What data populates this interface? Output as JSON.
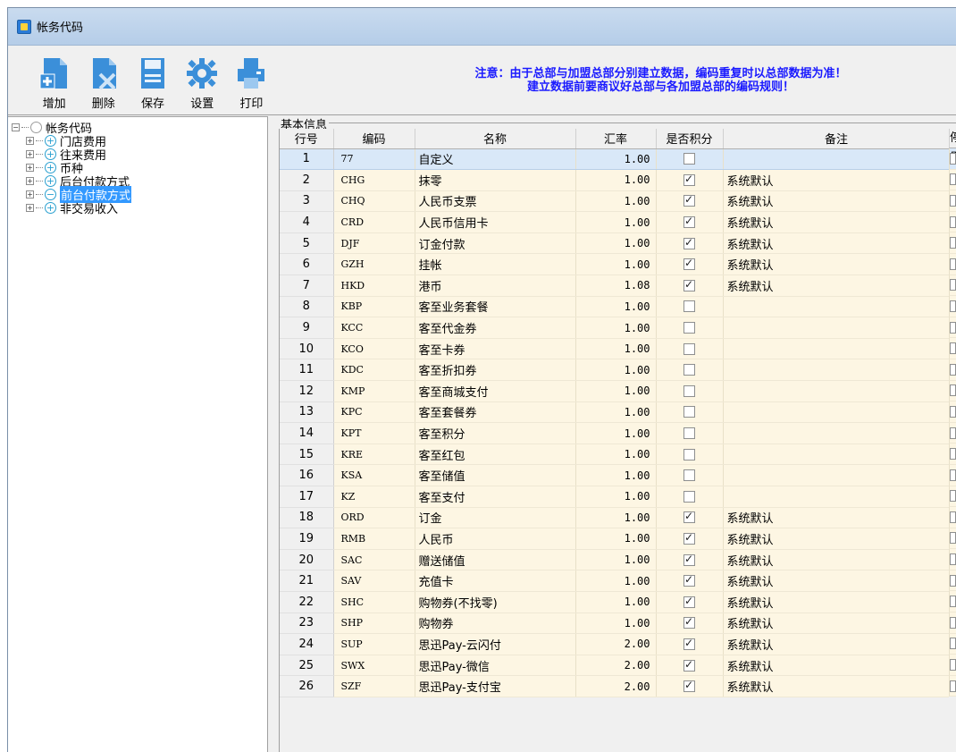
{
  "window": {
    "title": "帐务代码"
  },
  "toolbar": {
    "buttons": [
      {
        "label": "增加",
        "icon": "add-doc-icon"
      },
      {
        "label": "删除",
        "icon": "delete-doc-icon"
      },
      {
        "label": "保存",
        "icon": "save-icon"
      },
      {
        "label": "设置",
        "icon": "gear-icon"
      },
      {
        "label": "打印",
        "icon": "printer-icon"
      }
    ],
    "notice_line1": "注意：由于总部与加盟总部分别建立数据，编码重复时以总部数据为准！",
    "notice_line2": "建立数据前要商议好总部与各加盟总部的编码规则！"
  },
  "tree": {
    "root": "帐务代码",
    "items": [
      "门店费用",
      "往来费用",
      "币种",
      "后台付款方式",
      "前台付款方式",
      "非交易收入"
    ],
    "selected": "前台付款方式"
  },
  "group_label": "基本信息",
  "table": {
    "headers": [
      "行号",
      "编码",
      "名称",
      "汇率",
      "是否积分",
      "备注",
      "停用"
    ],
    "rows": [
      {
        "ln": "1",
        "code": "77",
        "name": "自定义",
        "rate": "1.00",
        "points": false,
        "note": "",
        "disabled": false
      },
      {
        "ln": "2",
        "code": "CHG",
        "name": "抹零",
        "rate": "1.00",
        "points": true,
        "note": "系统默认",
        "disabled": false
      },
      {
        "ln": "3",
        "code": "CHQ",
        "name": "人民币支票",
        "rate": "1.00",
        "points": true,
        "note": "系统默认",
        "disabled": false
      },
      {
        "ln": "4",
        "code": "CRD",
        "name": "人民币信用卡",
        "rate": "1.00",
        "points": true,
        "note": "系统默认",
        "disabled": false
      },
      {
        "ln": "5",
        "code": "DJF",
        "name": "订金付款",
        "rate": "1.00",
        "points": true,
        "note": "系统默认",
        "disabled": false
      },
      {
        "ln": "6",
        "code": "GZH",
        "name": "挂帐",
        "rate": "1.00",
        "points": true,
        "note": "系统默认",
        "disabled": false
      },
      {
        "ln": "7",
        "code": "HKD",
        "name": "港币",
        "rate": "1.08",
        "points": true,
        "note": "系统默认",
        "disabled": false
      },
      {
        "ln": "8",
        "code": "KBP",
        "name": "客至业务套餐",
        "rate": "1.00",
        "points": false,
        "note": "",
        "disabled": false
      },
      {
        "ln": "9",
        "code": "KCC",
        "name": "客至代金券",
        "rate": "1.00",
        "points": false,
        "note": "",
        "disabled": false
      },
      {
        "ln": "10",
        "code": "KCO",
        "name": "客至卡券",
        "rate": "1.00",
        "points": false,
        "note": "",
        "disabled": false
      },
      {
        "ln": "11",
        "code": "KDC",
        "name": "客至折扣券",
        "rate": "1.00",
        "points": false,
        "note": "",
        "disabled": false
      },
      {
        "ln": "12",
        "code": "KMP",
        "name": "客至商城支付",
        "rate": "1.00",
        "points": false,
        "note": "",
        "disabled": false
      },
      {
        "ln": "13",
        "code": "KPC",
        "name": "客至套餐券",
        "rate": "1.00",
        "points": false,
        "note": "",
        "disabled": false
      },
      {
        "ln": "14",
        "code": "KPT",
        "name": "客至积分",
        "rate": "1.00",
        "points": false,
        "note": "",
        "disabled": false
      },
      {
        "ln": "15",
        "code": "KRE",
        "name": "客至红包",
        "rate": "1.00",
        "points": false,
        "note": "",
        "disabled": false
      },
      {
        "ln": "16",
        "code": "KSA",
        "name": "客至储值",
        "rate": "1.00",
        "points": false,
        "note": "",
        "disabled": false
      },
      {
        "ln": "17",
        "code": "KZ",
        "name": "客至支付",
        "rate": "1.00",
        "points": false,
        "note": "",
        "disabled": false
      },
      {
        "ln": "18",
        "code": "ORD",
        "name": "订金",
        "rate": "1.00",
        "points": true,
        "note": "系统默认",
        "disabled": false
      },
      {
        "ln": "19",
        "code": "RMB",
        "name": "人民币",
        "rate": "1.00",
        "points": true,
        "note": "系统默认",
        "disabled": false
      },
      {
        "ln": "20",
        "code": "SAC",
        "name": "赠送储值",
        "rate": "1.00",
        "points": true,
        "note": "系统默认",
        "disabled": false
      },
      {
        "ln": "21",
        "code": "SAV",
        "name": "充值卡",
        "rate": "1.00",
        "points": true,
        "note": "系统默认",
        "disabled": false
      },
      {
        "ln": "22",
        "code": "SHC",
        "name": "购物券(不找零)",
        "rate": "1.00",
        "points": true,
        "note": "系统默认",
        "disabled": false
      },
      {
        "ln": "23",
        "code": "SHP",
        "name": "购物券",
        "rate": "1.00",
        "points": true,
        "note": "系统默认",
        "disabled": false
      },
      {
        "ln": "24",
        "code": "SUP",
        "name": "思迅Pay-云闪付",
        "rate": "2.00",
        "points": true,
        "note": "系统默认",
        "disabled": false
      },
      {
        "ln": "25",
        "code": "SWX",
        "name": "思迅Pay-微信",
        "rate": "2.00",
        "points": true,
        "note": "系统默认",
        "disabled": false
      },
      {
        "ln": "26",
        "code": "SZF",
        "name": "思迅Pay-支付宝",
        "rate": "2.00",
        "points": true,
        "note": "系统默认",
        "disabled": false
      }
    ]
  },
  "colors": {
    "notice": "#1a1aff",
    "selected": "#3399ff",
    "row_bg": "#fdf6e3",
    "row_selected": "#d9e8f8"
  }
}
